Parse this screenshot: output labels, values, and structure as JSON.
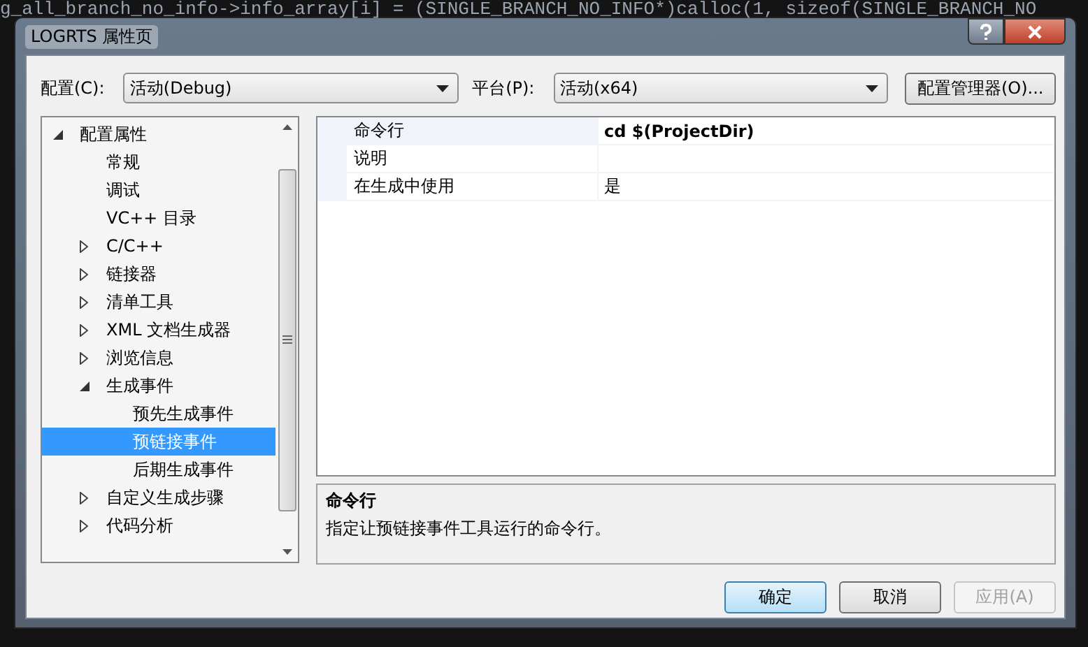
{
  "background_code": "g_all_branch_no_info->info_array[i] = (SINGLE_BRANCH_NO_INFO*)calloc(1, sizeof(SINGLE_BRANCH_NO",
  "window": {
    "title": "LOGRTS 属性页"
  },
  "configuration": {
    "label": "配置(C):",
    "value": "活动(Debug)"
  },
  "platform": {
    "label": "平台(P):",
    "value": "活动(x64)"
  },
  "config_manager_button": "配置管理器(O)...",
  "tree": [
    {
      "label": "配置属性",
      "expanded": true,
      "selected": false,
      "children": [
        {
          "label": "常规",
          "selected": false
        },
        {
          "label": "调试",
          "selected": false
        },
        {
          "label": "VC++ 目录",
          "selected": false
        },
        {
          "label": "C/C++",
          "expanded": false,
          "selected": false
        },
        {
          "label": "链接器",
          "expanded": false,
          "selected": false
        },
        {
          "label": "清单工具",
          "expanded": false,
          "selected": false
        },
        {
          "label": "XML 文档生成器",
          "expanded": false,
          "selected": false
        },
        {
          "label": "浏览信息",
          "expanded": false,
          "selected": false
        },
        {
          "label": "生成事件",
          "expanded": true,
          "selected": false,
          "children": [
            {
              "label": "预先生成事件",
              "selected": false
            },
            {
              "label": "预链接事件",
              "selected": true
            },
            {
              "label": "后期生成事件",
              "selected": false
            }
          ]
        },
        {
          "label": "自定义生成步骤",
          "expanded": false,
          "selected": false
        },
        {
          "label": "代码分析",
          "expanded": false,
          "selected": false
        }
      ]
    }
  ],
  "properties": [
    {
      "name": "命令行",
      "value": "cd $(ProjectDir)",
      "modified": true,
      "selected": true
    },
    {
      "name": "说明",
      "selected": false
    },
    {
      "name": "在生成中使用",
      "value": "是",
      "modified": false,
      "selected": false
    }
  ],
  "description": {
    "title": "命令行",
    "text": "指定让预链接事件工具运行的命令行。"
  },
  "buttons": [
    {
      "label": "确定",
      "kind": "default",
      "disabled": false
    },
    {
      "label": "取消",
      "kind": "normal",
      "disabled": false
    },
    {
      "label": "应用(A)",
      "kind": "normal",
      "disabled": true
    }
  ]
}
